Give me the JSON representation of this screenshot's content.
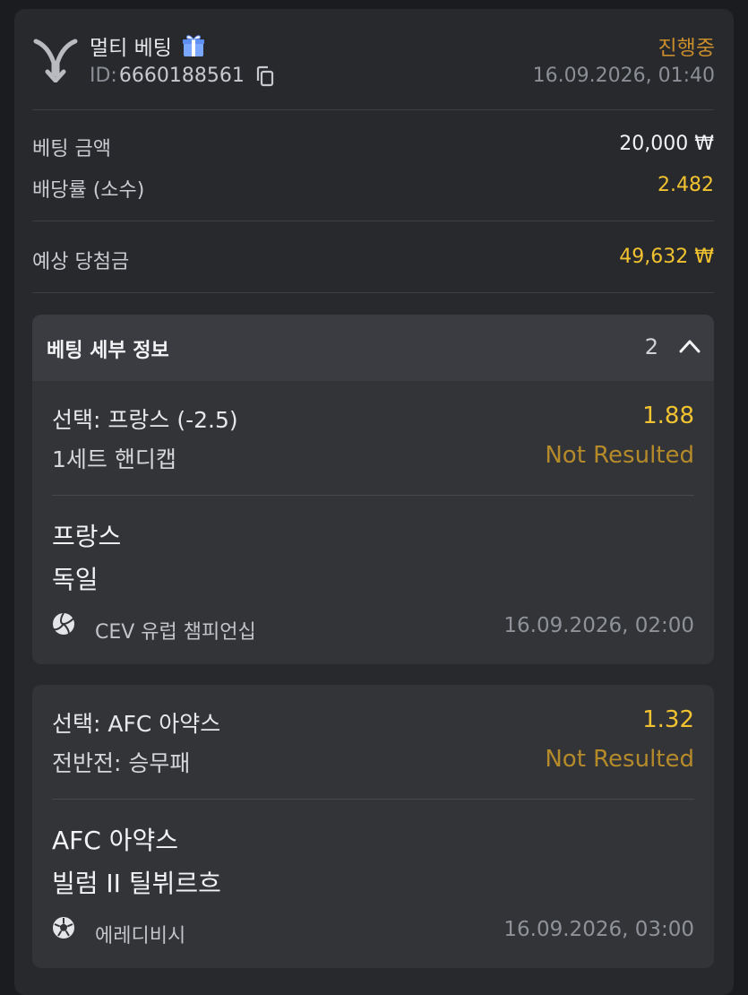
{
  "header": {
    "bet_type": "멀티 베팅",
    "id_label": "ID:",
    "id_value": "6660188561",
    "status": "진행중",
    "datetime": "16.09.2026, 01:40"
  },
  "summary": {
    "stake_label": "베팅 금액",
    "stake_value": "20,000 ₩",
    "odds_label": "배당률 (소수)",
    "odds_value": "2.482",
    "payout_label": "예상 당첨금",
    "payout_value": "49,632 ₩"
  },
  "details": {
    "title": "베팅 세부 정보",
    "count": "2"
  },
  "selections": [
    {
      "pick": "선택: 프랑스 (-2.5)",
      "odds": "1.88",
      "market": "1세트 핸디캡",
      "result": "Not Resulted",
      "team1": "프랑스",
      "team2": "독일",
      "sport_icon": "volleyball-icon",
      "league": "CEV 유럽 챔피언십",
      "event_date": "16.09.2026, 02:00"
    },
    {
      "pick": "선택: AFC 아약스",
      "odds": "1.32",
      "market": "전반전: 승무패",
      "result": "Not Resulted",
      "team1": "AFC 아약스",
      "team2": "빌럼 II 틸뷔르흐",
      "sport_icon": "soccer-ball-icon",
      "league": "에레디비시",
      "event_date": "16.09.2026, 03:00"
    }
  ],
  "colors": {
    "accent_yellow": "#f2c230",
    "status_orange": "#c98d2c",
    "card_bg": "#27292d",
    "selection_bg": "#323438"
  }
}
